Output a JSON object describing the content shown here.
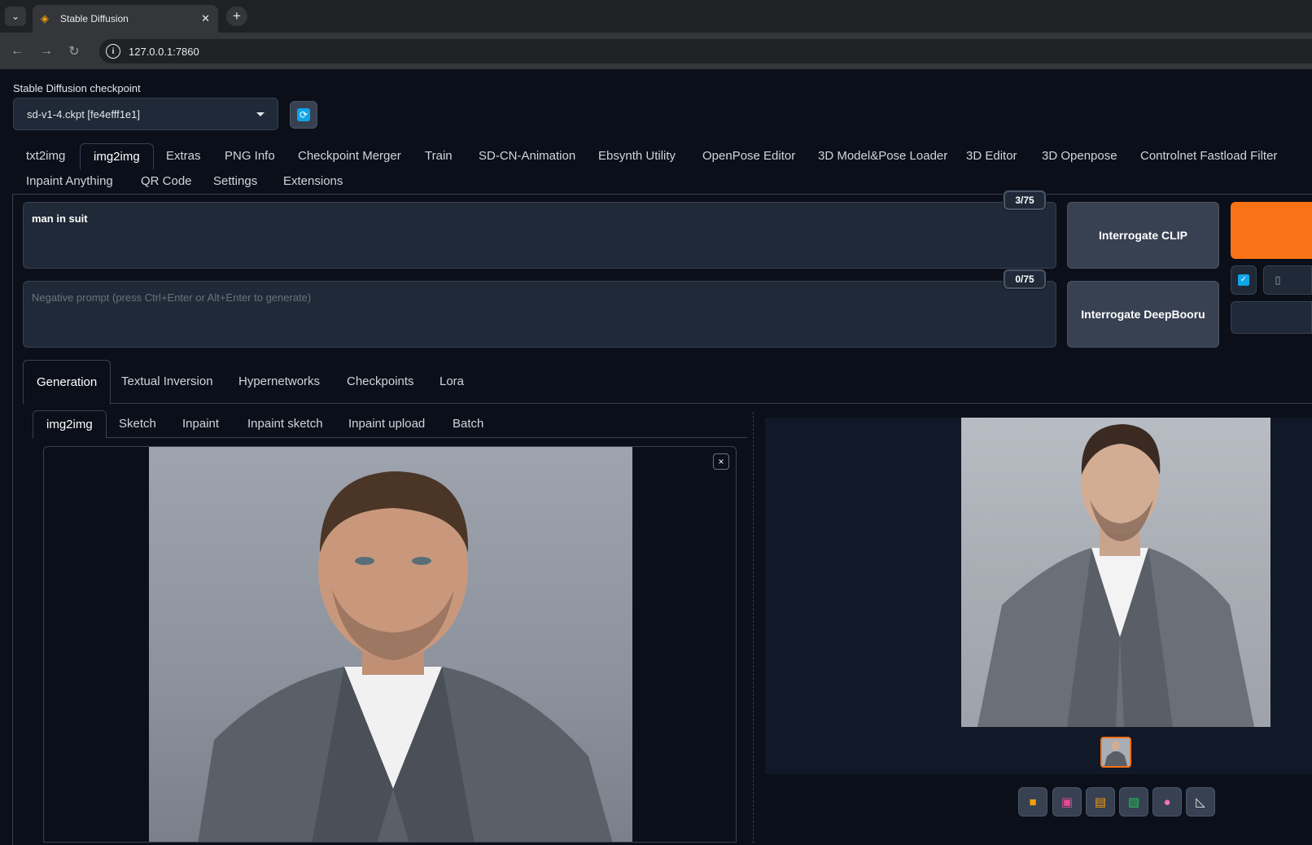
{
  "browser": {
    "tab_title": "Stable Diffusion",
    "url": "127.0.0.1:7860"
  },
  "checkpoint": {
    "label": "Stable Diffusion checkpoint",
    "value": "sd-v1-4.ckpt [fe4efff1e1]"
  },
  "main_tabs": [
    "txt2img",
    "img2img",
    "Extras",
    "PNG Info",
    "Checkpoint Merger",
    "Train",
    "SD-CN-Animation",
    "Ebsynth Utility",
    "OpenPose Editor",
    "3D Model&Pose Loader",
    "3D Editor",
    "3D Openpose",
    "Controlnet Fastload Filter",
    "Inpaint Anything",
    "QR Code",
    "Settings",
    "Extensions"
  ],
  "prompt": {
    "text": "man in suit",
    "counter": "3/75"
  },
  "negative_prompt": {
    "placeholder": "Negative prompt (press Ctrl+Enter or Alt+Enter to generate)",
    "counter": "0/75"
  },
  "buttons": {
    "interrogate_clip": "Interrogate CLIP",
    "interrogate_deepbooru": "Interrogate DeepBooru"
  },
  "sub_tabs": [
    "Generation",
    "Textual Inversion",
    "Hypernetworks",
    "Checkpoints",
    "Lora"
  ],
  "img_tabs": [
    "img2img",
    "Sketch",
    "Inpaint",
    "Inpaint sketch",
    "Inpaint upload",
    "Batch"
  ],
  "close_glyph": "×",
  "colors": {
    "accent": "#f97316",
    "background": "#0b0f19",
    "panel": "#1f2937"
  }
}
